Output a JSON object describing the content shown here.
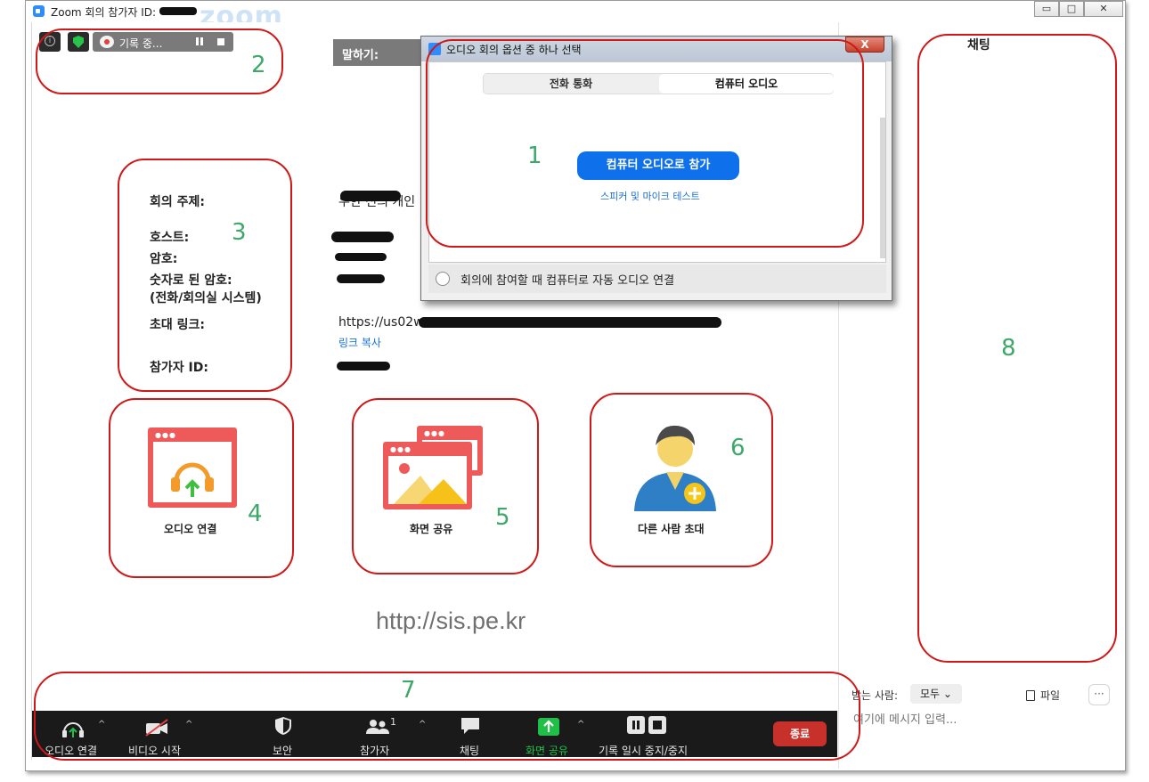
{
  "window": {
    "title": "Zoom 회의 참가자 ID:",
    "watermark": "zoom",
    "minimize_symbol": "▭",
    "maximize_symbol": "□",
    "close_symbol": "✕"
  },
  "status": {
    "recording_label": "기록 중...",
    "speaking_label": "말하기:"
  },
  "meeting_info": {
    "topic_label": "회의 주제:",
    "topic_value": "우한 신의 개인",
    "host_label": "호스트:",
    "password_label": "암호:",
    "numeric_password_label": "숫자로 된 암호:",
    "numeric_password_sub": "(전화/회의실 시스템)",
    "invite_link_label": "초대 링크:",
    "invite_link_value": "https://us02w",
    "copy_link": "링크 복사",
    "participant_id_label": "참가자 ID:"
  },
  "tiles": {
    "audio": "오디오 연결",
    "share": "화면 공유",
    "invite": "다른 사람 초대"
  },
  "watermark_url": "http://sis.pe.kr",
  "toolbar": {
    "audio": "오디오 연결",
    "video": "비디오 시작",
    "security": "보안",
    "participants": "참가자",
    "participants_count": "1",
    "chat": "채팅",
    "share": "화면 공유",
    "record": "기록 일시 중지/중지",
    "end": "종료",
    "caret": "^"
  },
  "dialog": {
    "title": "오디오 회의 옵션 중 하나 선택",
    "close": "X",
    "tab_phone": "전화 통화",
    "tab_computer": "컴퓨터 오디오",
    "join_button": "컴퓨터 오디오로 참가",
    "test_link": "스피커 및 마이크 테스트",
    "auto_join_label": "회의에 참여할 때 컴퓨터로 자동 오디오 연결"
  },
  "chat": {
    "title": "채팅",
    "recipient_label": "받는 사람:",
    "recipient_value": "모두",
    "file_label": "파일",
    "more_label": "···",
    "input_placeholder": "여기에 메시지 입력..."
  },
  "annotations": [
    "1",
    "2",
    "3",
    "4",
    "5",
    "6",
    "7",
    "8"
  ],
  "colors": {
    "accent_blue": "#0e71eb",
    "end_red": "#c8302b",
    "share_green": "#20c048",
    "tile_red": "#ee5a5a",
    "annotation_red": "#d01818",
    "annotation_number_green": "#3da86a"
  }
}
